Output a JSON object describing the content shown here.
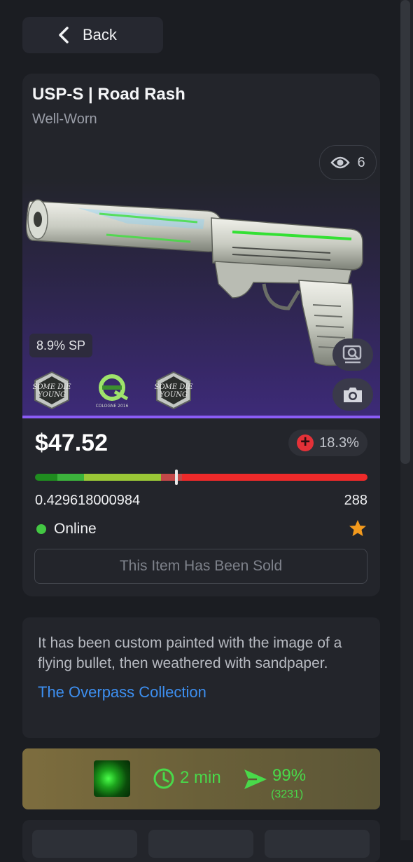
{
  "nav": {
    "back_label": "Back"
  },
  "item": {
    "title": "USP-S | Road Rash",
    "wear": "Well-Worn",
    "views": "6",
    "float_badge": "8.9% SP",
    "price": "$47.52",
    "price_change": "18.3%",
    "float_value": "0.429618000984",
    "pattern": "288",
    "float_fraction": 0.43,
    "status": "Online",
    "sold_label": "This Item Has Been Sold",
    "stickers": [
      "some-die-young-sticker",
      "optic-gaming-sticker",
      "some-die-young-sticker"
    ]
  },
  "description": {
    "text": "It has been custom painted with the image of a flying bullet, then weathered with sandpaper.",
    "collection": "The Overpass Collection"
  },
  "seller": {
    "delivery_time": "2 min",
    "success_rate": "99%",
    "trades": "(3231)"
  },
  "colors": {
    "accent": "#8b5cf6",
    "link": "#3d8ff0",
    "online": "#43c743",
    "seller_green": "#49d94a",
    "change_red": "#e43138"
  }
}
